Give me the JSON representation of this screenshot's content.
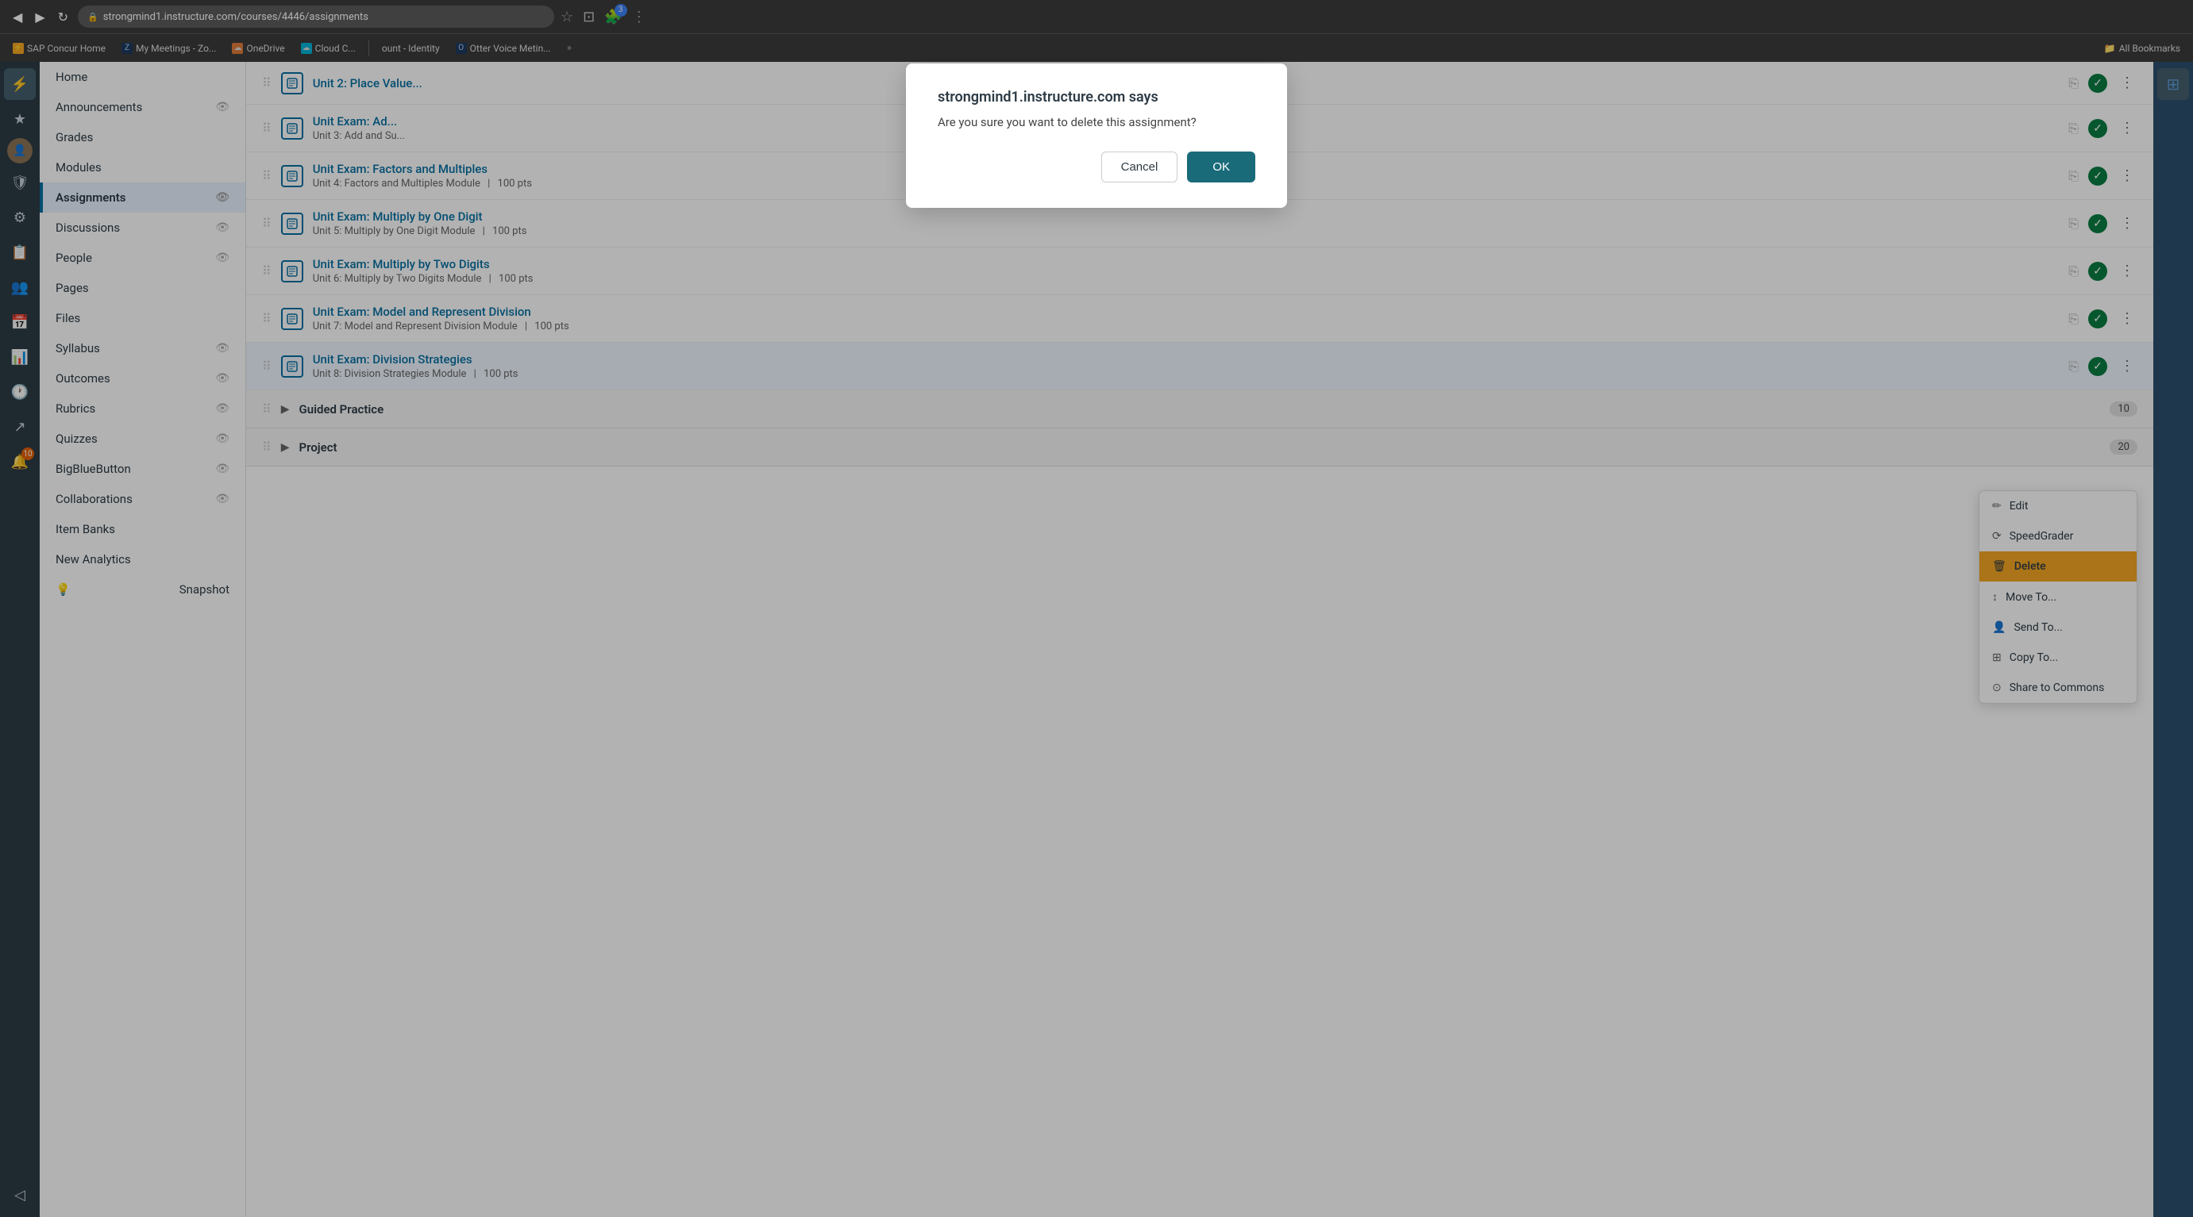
{
  "browser": {
    "url": "strongmind1.instructure.com/courses/4446/assignments",
    "nav_back": "◀",
    "nav_forward": "▶",
    "refresh": "↻"
  },
  "bookmarks": [
    {
      "id": "sap",
      "label": "SAP Concur Home",
      "color": "bm-yellow",
      "icon": "⚡"
    },
    {
      "id": "zoom",
      "label": "My Meetings - Zo...",
      "color": "bm-blue",
      "icon": "Z"
    },
    {
      "id": "onedrive",
      "label": "OneDrive",
      "color": "bm-orange",
      "icon": "☁"
    },
    {
      "id": "cloud",
      "label": "Cloud C...",
      "color": "bm-teal",
      "icon": "☁"
    },
    {
      "id": "account",
      "label": "ount - Identity",
      "color": "bm-blue",
      "icon": "A"
    },
    {
      "id": "otter",
      "label": "Otter Voice Metin...",
      "color": "bm-blue",
      "icon": "O"
    }
  ],
  "bookmarks_overflow": "»",
  "bookmarks_folder": "All Bookmarks",
  "rail_icons": [
    {
      "id": "lightning",
      "symbol": "⚡",
      "active": true
    },
    {
      "id": "star",
      "symbol": "★",
      "active": false
    },
    {
      "id": "avatar",
      "symbol": "👤",
      "active": false
    },
    {
      "id": "shield",
      "symbol": "🛡",
      "active": false
    },
    {
      "id": "activity",
      "symbol": "⚙",
      "active": false
    },
    {
      "id": "book",
      "symbol": "📋",
      "active": false
    },
    {
      "id": "people",
      "symbol": "👥",
      "active": false
    },
    {
      "id": "calendar",
      "symbol": "📅",
      "active": false
    },
    {
      "id": "chart",
      "symbol": "📊",
      "active": false
    },
    {
      "id": "clock",
      "symbol": "🕐",
      "active": false
    },
    {
      "id": "arrow",
      "symbol": "↗",
      "active": false
    },
    {
      "id": "badge",
      "symbol": "🔔",
      "active": false,
      "badge": "10"
    }
  ],
  "sidebar": {
    "items": [
      {
        "id": "home",
        "label": "Home",
        "show_eye": false
      },
      {
        "id": "announcements",
        "label": "Announcements",
        "show_eye": true
      },
      {
        "id": "grades",
        "label": "Grades",
        "show_eye": false
      },
      {
        "id": "modules",
        "label": "Modules",
        "show_eye": false
      },
      {
        "id": "assignments",
        "label": "Assignments",
        "show_eye": true,
        "active": true
      },
      {
        "id": "discussions",
        "label": "Discussions",
        "show_eye": true
      },
      {
        "id": "people",
        "label": "People",
        "show_eye": true
      },
      {
        "id": "pages",
        "label": "Pages",
        "show_eye": false
      },
      {
        "id": "files",
        "label": "Files",
        "show_eye": false
      },
      {
        "id": "syllabus",
        "label": "Syllabus",
        "show_eye": true
      },
      {
        "id": "outcomes",
        "label": "Outcomes",
        "show_eye": true
      },
      {
        "id": "rubrics",
        "label": "Rubrics",
        "show_eye": true
      },
      {
        "id": "quizzes",
        "label": "Quizzes",
        "show_eye": true
      },
      {
        "id": "bigbluebutton",
        "label": "BigBlueButton",
        "show_eye": true
      },
      {
        "id": "collaborations",
        "label": "Collaborations",
        "show_eye": true
      },
      {
        "id": "item-banks",
        "label": "Item Banks",
        "show_eye": false
      },
      {
        "id": "new-analytics",
        "label": "New Analytics",
        "show_eye": false
      },
      {
        "id": "snapshot",
        "label": "Snapshot",
        "show_eye": false
      }
    ]
  },
  "assignments": [
    {
      "id": "unit2",
      "title": "Unit 2: Place Value...",
      "meta": "",
      "pts": "",
      "highlighted": false
    },
    {
      "id": "unit-exam-add",
      "title": "Unit Exam: Ad...",
      "meta": "Unit 3: Add and Su...",
      "pts": "",
      "highlighted": false
    },
    {
      "id": "unit-exam-factors",
      "title": "Unit Exam: Factors and Multiples",
      "meta": "Unit 4: Factors and Multiples Module",
      "pts": "100 pts",
      "highlighted": false
    },
    {
      "id": "unit-exam-multiply-one",
      "title": "Unit Exam: Multiply by One Digit",
      "meta": "Unit 5: Multiply by One Digit Module",
      "pts": "100 pts",
      "highlighted": false
    },
    {
      "id": "unit-exam-multiply-two",
      "title": "Unit Exam: Multiply by Two Digits",
      "meta": "Unit 6: Multiply by Two Digits Module",
      "pts": "100 pts",
      "highlighted": false
    },
    {
      "id": "unit-exam-division",
      "title": "Unit Exam: Model and Represent Division",
      "meta": "Unit 7: Model and Represent Division Module",
      "pts": "100 pts",
      "highlighted": false
    },
    {
      "id": "unit-exam-division-strategies",
      "title": "Unit Exam: Division Strategies",
      "meta": "Unit 8: Division Strategies Module",
      "pts": "100 pts",
      "highlighted": true
    }
  ],
  "sections": [
    {
      "id": "guided-practice",
      "label": "Guided Practice",
      "count": "10",
      "collapsed": true
    },
    {
      "id": "project",
      "label": "Project",
      "count": "20",
      "collapsed": true
    }
  ],
  "context_menu": {
    "items": [
      {
        "id": "edit",
        "label": "Edit",
        "icon": "✏"
      },
      {
        "id": "speedgrader",
        "label": "SpeedGrader",
        "icon": "⟳"
      },
      {
        "id": "delete",
        "label": "Delete",
        "icon": "🗑",
        "highlighted": true
      },
      {
        "id": "move-to",
        "label": "Move To...",
        "icon": "↕"
      },
      {
        "id": "send-to",
        "label": "Send To...",
        "icon": "👤"
      },
      {
        "id": "copy-to",
        "label": "Copy To...",
        "icon": "⊞"
      },
      {
        "id": "share-to-commons",
        "label": "Share to Commons",
        "icon": "⊙"
      }
    ]
  },
  "dialog": {
    "title": "strongmind1.instructure.com says",
    "message": "Are you sure you want to delete this assignment?",
    "cancel_label": "Cancel",
    "ok_label": "OK"
  }
}
